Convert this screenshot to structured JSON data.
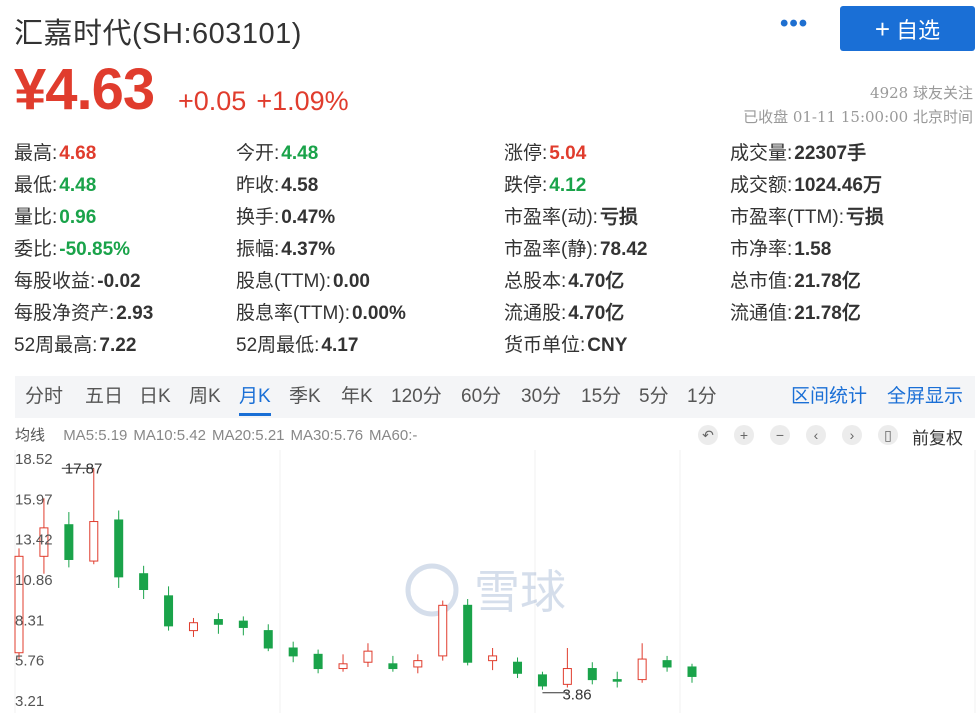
{
  "header": {
    "title": "汇嘉时代(SH:603101)",
    "more_icon": "more-dots-icon",
    "follow_label": "自选",
    "follow_plus": "+"
  },
  "quote": {
    "price": "¥4.63",
    "change": "+0.05",
    "change_pct": "+1.09%",
    "followers": "4928 球友关注",
    "status_time": "已收盘 01-11 15:00:00 北京时间"
  },
  "stats": [
    [
      {
        "label": "最高:",
        "value": "4.68",
        "color": "red"
      },
      {
        "label": "今开:",
        "value": "4.48",
        "color": "green"
      },
      {
        "label": "涨停:",
        "value": "5.04",
        "color": "red"
      },
      {
        "label": "成交量:",
        "value": "22307手",
        "color": "dark"
      }
    ],
    [
      {
        "label": "最低:",
        "value": "4.48",
        "color": "green"
      },
      {
        "label": "昨收:",
        "value": "4.58",
        "color": "dark"
      },
      {
        "label": "跌停:",
        "value": "4.12",
        "color": "green"
      },
      {
        "label": "成交额:",
        "value": "1024.46万",
        "color": "dark"
      }
    ],
    [
      {
        "label": "量比:",
        "value": "0.96",
        "color": "green"
      },
      {
        "label": "换手:",
        "value": "0.47%",
        "color": "dark"
      },
      {
        "label": "市盈率(动):",
        "value": "亏损",
        "color": "dark"
      },
      {
        "label": "市盈率(TTM):",
        "value": "亏损",
        "color": "dark"
      }
    ],
    [
      {
        "label": "委比:",
        "value": "-50.85%",
        "color": "green"
      },
      {
        "label": "振幅:",
        "value": "4.37%",
        "color": "dark"
      },
      {
        "label": "市盈率(静):",
        "value": "78.42",
        "color": "dark"
      },
      {
        "label": "市净率:",
        "value": "1.58",
        "color": "dark"
      }
    ],
    [
      {
        "label": "每股收益:",
        "value": "-0.02",
        "color": "dark"
      },
      {
        "label": "股息(TTM):",
        "value": "0.00",
        "color": "dark"
      },
      {
        "label": "总股本:",
        "value": "4.70亿",
        "color": "dark"
      },
      {
        "label": "总市值:",
        "value": "21.78亿",
        "color": "dark"
      }
    ],
    [
      {
        "label": "每股净资产:",
        "value": "2.93",
        "color": "dark"
      },
      {
        "label": "股息率(TTM):",
        "value": "0.00%",
        "color": "dark"
      },
      {
        "label": "流通股:",
        "value": "4.70亿",
        "color": "dark"
      },
      {
        "label": "流通值:",
        "value": "21.78亿",
        "color": "dark"
      }
    ],
    [
      {
        "label": "52周最高:",
        "value": "7.22",
        "color": "dark"
      },
      {
        "label": "52周最低:",
        "value": "4.17",
        "color": "dark"
      },
      {
        "label": "货币单位:",
        "value": "CNY",
        "color": "dark"
      }
    ]
  ],
  "tabs": [
    "分时",
    "五日",
    "日K",
    "周K",
    "月K",
    "季K",
    "年K",
    "120分",
    "60分",
    "30分",
    "15分",
    "5分",
    "1分"
  ],
  "active_tab": 4,
  "tab_links": [
    "区间统计",
    "全屏显示"
  ],
  "ma": {
    "title": "均线",
    "items": [
      "MA5:5.19",
      "MA10:5.42",
      "MA20:5.21",
      "MA30:5.76",
      "MA60:-"
    ]
  },
  "toolbar": {
    "icons": [
      "undo-icon",
      "zoom-in-icon",
      "zoom-out-icon",
      "scroll-left-icon",
      "scroll-right-icon",
      "candle-type-icon"
    ],
    "adjust_label": "前复权"
  },
  "watermark": "雪球",
  "colors": {
    "up": "#e03c2d",
    "down": "#1aa34a",
    "accent": "#1a6fd6"
  },
  "chart_data": {
    "type": "candlestick",
    "y_ticks": [
      "18.52",
      "15.97",
      "13.42",
      "10.86",
      "8.31",
      "5.76",
      "3.21"
    ],
    "ylim": [
      3.21,
      18.52
    ],
    "annotations": [
      {
        "label": "17.87",
        "value": 17.87,
        "index": 3
      },
      {
        "label": "3.86",
        "value": 3.86,
        "index": 21
      }
    ],
    "candles": [
      {
        "o": 6.2,
        "c": 12.3,
        "h": 12.8,
        "l": 5.76
      },
      {
        "o": 12.3,
        "c": 14.1,
        "h": 15.97,
        "l": 11.2
      },
      {
        "o": 14.3,
        "c": 12.1,
        "h": 15.1,
        "l": 11.6
      },
      {
        "o": 12.0,
        "c": 14.5,
        "h": 17.87,
        "l": 11.8
      },
      {
        "o": 14.6,
        "c": 11.0,
        "h": 15.2,
        "l": 10.3
      },
      {
        "o": 11.2,
        "c": 10.2,
        "h": 11.7,
        "l": 9.6
      },
      {
        "o": 9.8,
        "c": 7.9,
        "h": 10.4,
        "l": 7.6
      },
      {
        "o": 7.6,
        "c": 8.1,
        "h": 8.4,
        "l": 7.2
      },
      {
        "o": 8.3,
        "c": 8.0,
        "h": 8.7,
        "l": 7.4
      },
      {
        "o": 8.2,
        "c": 7.8,
        "h": 8.5,
        "l": 7.3
      },
      {
        "o": 7.6,
        "c": 6.5,
        "h": 8.0,
        "l": 6.3
      },
      {
        "o": 6.5,
        "c": 6.0,
        "h": 6.9,
        "l": 5.6
      },
      {
        "o": 6.1,
        "c": 5.2,
        "h": 6.4,
        "l": 4.9
      },
      {
        "o": 5.2,
        "c": 5.5,
        "h": 6.1,
        "l": 5.0
      },
      {
        "o": 5.6,
        "c": 6.3,
        "h": 6.8,
        "l": 5.3
      },
      {
        "o": 5.5,
        "c": 5.2,
        "h": 6.0,
        "l": 5.0
      },
      {
        "o": 5.3,
        "c": 5.7,
        "h": 6.1,
        "l": 4.9
      },
      {
        "o": 6.0,
        "c": 9.2,
        "h": 9.5,
        "l": 5.7
      },
      {
        "o": 9.2,
        "c": 5.6,
        "h": 9.6,
        "l": 5.4
      },
      {
        "o": 5.7,
        "c": 6.0,
        "h": 6.5,
        "l": 5.1
      },
      {
        "o": 5.6,
        "c": 4.9,
        "h": 5.9,
        "l": 4.6
      },
      {
        "o": 4.8,
        "c": 4.1,
        "h": 5.0,
        "l": 3.86
      },
      {
        "o": 4.2,
        "c": 5.2,
        "h": 6.5,
        "l": 4.0
      },
      {
        "o": 5.2,
        "c": 4.5,
        "h": 5.6,
        "l": 4.2
      },
      {
        "o": 4.5,
        "c": 4.4,
        "h": 5.0,
        "l": 4.0
      },
      {
        "o": 4.5,
        "c": 5.8,
        "h": 6.8,
        "l": 4.3
      },
      {
        "o": 5.7,
        "c": 5.3,
        "h": 6.0,
        "l": 5.0
      },
      {
        "o": 5.3,
        "c": 4.7,
        "h": 5.5,
        "l": 4.3
      }
    ]
  }
}
